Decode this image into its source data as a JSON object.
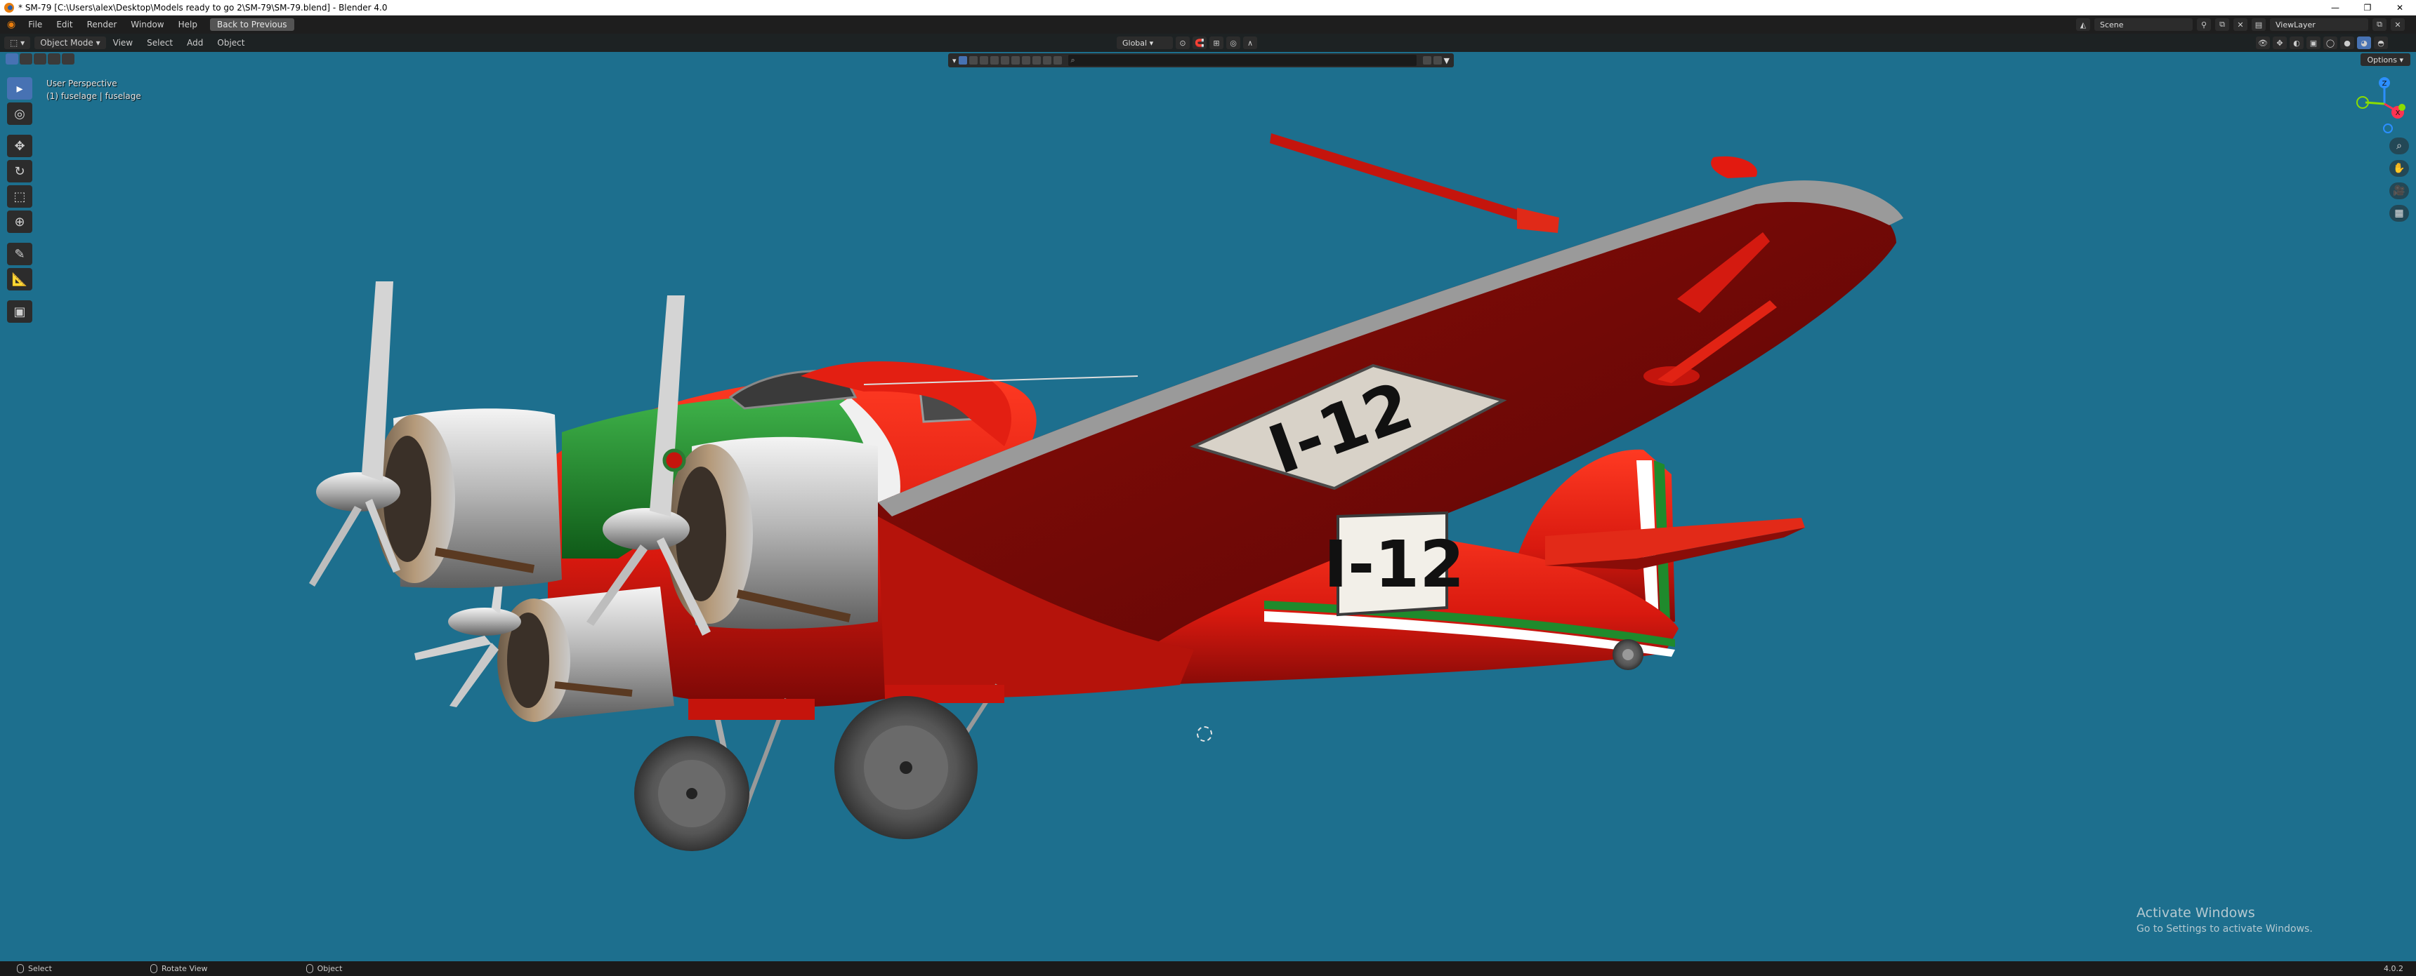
{
  "window": {
    "title": "* SM-79 [C:\\Users\\alex\\Desktop\\Models ready to go 2\\SM-79\\SM-79.blend] - Blender 4.0",
    "minimize_icon": "minimize-icon",
    "maximize_icon": "restore-icon",
    "close_icon": "close-icon"
  },
  "topbar": {
    "menus": [
      "File",
      "Edit",
      "Render",
      "Window",
      "Help"
    ],
    "back_button": "Back to Previous",
    "scene": "Scene",
    "view_layer": "ViewLayer"
  },
  "viewport_header": {
    "mode": "Object Mode",
    "menus": [
      "View",
      "Select",
      "Add",
      "Object"
    ],
    "transform_orientation": "Global",
    "options": "Options"
  },
  "viewport": {
    "perspective": "User Perspective",
    "object": "(1) fuselage | fuselage",
    "registration_wing": "I-12",
    "registration_fuselage": "I-12"
  },
  "tools": [
    {
      "name": "select-box-tool",
      "glyph": "▸",
      "active": true
    },
    {
      "name": "cursor-tool",
      "glyph": "◎",
      "active": false
    },
    {
      "name": "move-tool",
      "glyph": "✥",
      "active": false
    },
    {
      "name": "rotate-tool",
      "glyph": "↻",
      "active": false
    },
    {
      "name": "scale-tool",
      "glyph": "⬚",
      "active": false
    },
    {
      "name": "transform-tool",
      "glyph": "⊕",
      "active": false
    },
    {
      "name": "annotate-tool",
      "glyph": "✎",
      "active": false
    },
    {
      "name": "measure-tool",
      "glyph": "📐",
      "active": false
    },
    {
      "name": "add-cube-tool",
      "glyph": "▣",
      "active": false
    }
  ],
  "gizmo": {
    "x_label": "X",
    "y_label": "Y",
    "z_label": "Z"
  },
  "watermark": {
    "line1": "Activate Windows",
    "line2": "Go to Settings to activate Windows."
  },
  "statusbar": {
    "select": "Select",
    "rotate_view": "Rotate View",
    "object": "Object",
    "version": "4.0.2"
  },
  "colors": {
    "viewport_bg": "#1d6f8e",
    "accent": "#4772b3",
    "plane_red": "#d8190f",
    "plane_green": "#1f8a2c"
  }
}
